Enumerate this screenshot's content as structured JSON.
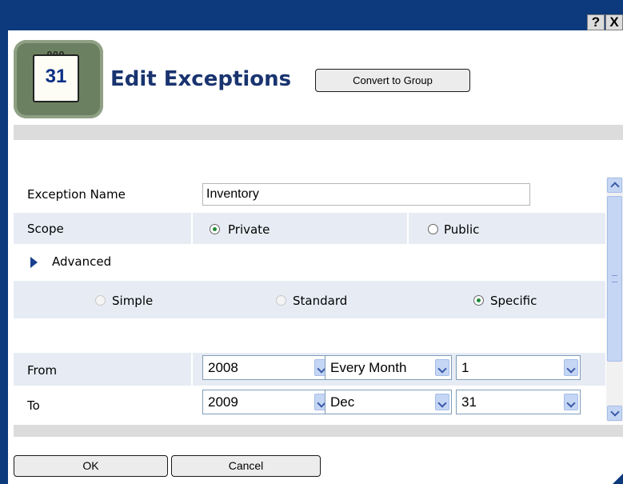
{
  "window": {
    "help_label": "?",
    "close_label": "X"
  },
  "header": {
    "icon_day": "31",
    "title": "Edit Exceptions",
    "convert_button_label": "Convert to Group"
  },
  "form": {
    "exception_name": {
      "label": "Exception Name",
      "value": "Inventory"
    },
    "scope": {
      "label": "Scope",
      "options": [
        {
          "label": "Private",
          "checked": true
        },
        {
          "label": "Public",
          "checked": false
        }
      ]
    },
    "advanced": {
      "label": "Advanced"
    },
    "mode": {
      "options": [
        {
          "label": "Simple",
          "checked": false,
          "enabled": false
        },
        {
          "label": "Standard",
          "checked": false,
          "enabled": false
        },
        {
          "label": "Specific",
          "checked": true,
          "enabled": true
        }
      ]
    },
    "from": {
      "label": "From",
      "year": "2008",
      "month": "Every Month",
      "day": "1"
    },
    "to": {
      "label": "To",
      "year": "2009",
      "month": "Dec",
      "day": "31"
    }
  },
  "footer": {
    "ok_label": "OK",
    "cancel_label": "Cancel"
  },
  "colors": {
    "titlebar": "#0c3a7c",
    "title_text": "#19346f",
    "row_shade": "#e7ecf4",
    "radio_checked": "#1f8a3b"
  }
}
